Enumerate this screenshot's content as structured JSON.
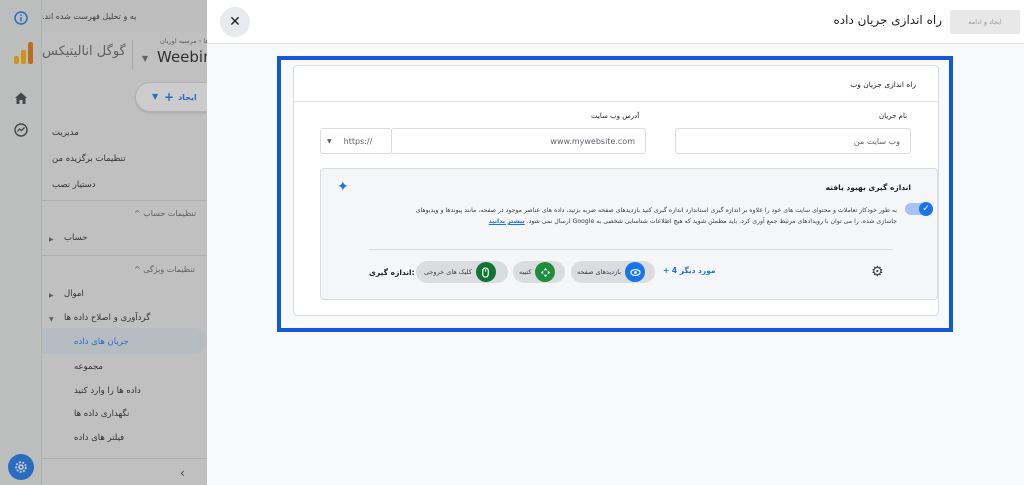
{
  "background_app": {
    "top_message": "یه و تحلیل فهرست شده اند.",
    "logo_title": "گوگل انالیتیکس",
    "breadcrumb": "ت ها ‹ مرسیه اوریان",
    "property_name": "Weebin",
    "create_label": "ایجاد",
    "nav": {
      "admin": "مدیریت",
      "preferences": "تنظیمات برگزیده من",
      "setup_assistant": "دستیار نصب",
      "account_settings_header": "تنظیمات حساب",
      "account": "حساب",
      "property_settings_header": "تنظیمات ویژگی",
      "assets": "اموال",
      "data_collection": "گردآوری و اصلاح داده ها",
      "data_streams": "جریان های داده",
      "data_collection_sub": "مجموعه",
      "data_import": "داده ها را وارد کنید",
      "data_retention": "نگهداری داده ها",
      "data_filters": "فیلتر های داده"
    }
  },
  "panel": {
    "title": "راه اندازی جریان داده",
    "create_continue": "ایجاد و ادامه",
    "card_title": "راه اندازی جریان وب",
    "website_url_label": "آدرس وب سایت",
    "protocol": "https://",
    "website_url_placeholder": "www.mywebsite.com",
    "stream_name_label": "نام جریان",
    "stream_name_placeholder": "وب سایت من",
    "enhanced_measurement": {
      "title": "اندازه گیری بهبود یافته",
      "description": "به طور خودکار تعاملات و محتوای سایت های خود را علاوه بر اندازه گیری استاندارد اندازه گیری کنید بازدیدهای صفحه ضربه بزنید، داده های عناصر موجود در صفحه، مانند پیوندها و ویدیوهای جاسازی شده، را می توان با رویدادهای مرتبط جمع آوری کرد. باید مطمئن شوید که هیچ اطلاعات شناسایی شخصی به Google ارسال نمی شود.",
      "learn_more": "بیشتر بدانید",
      "more_label": "+ 4 مورد دیگر",
      "chips": [
        {
          "label": "بازدیدهای صفحه",
          "icon": "eye-icon",
          "color": "#1a73e8"
        },
        {
          "label": "کتیبه",
          "icon": "scroll-icon",
          "color": "#1e8e3e"
        },
        {
          "label": "کلیک های خروجی",
          "icon": "mouse-icon",
          "color": "#137333"
        }
      ],
      "measuring_label": "اندازه گیری:"
    }
  },
  "colors": {
    "highlight_border": "#1558d6",
    "accent": "#1a73e8"
  }
}
